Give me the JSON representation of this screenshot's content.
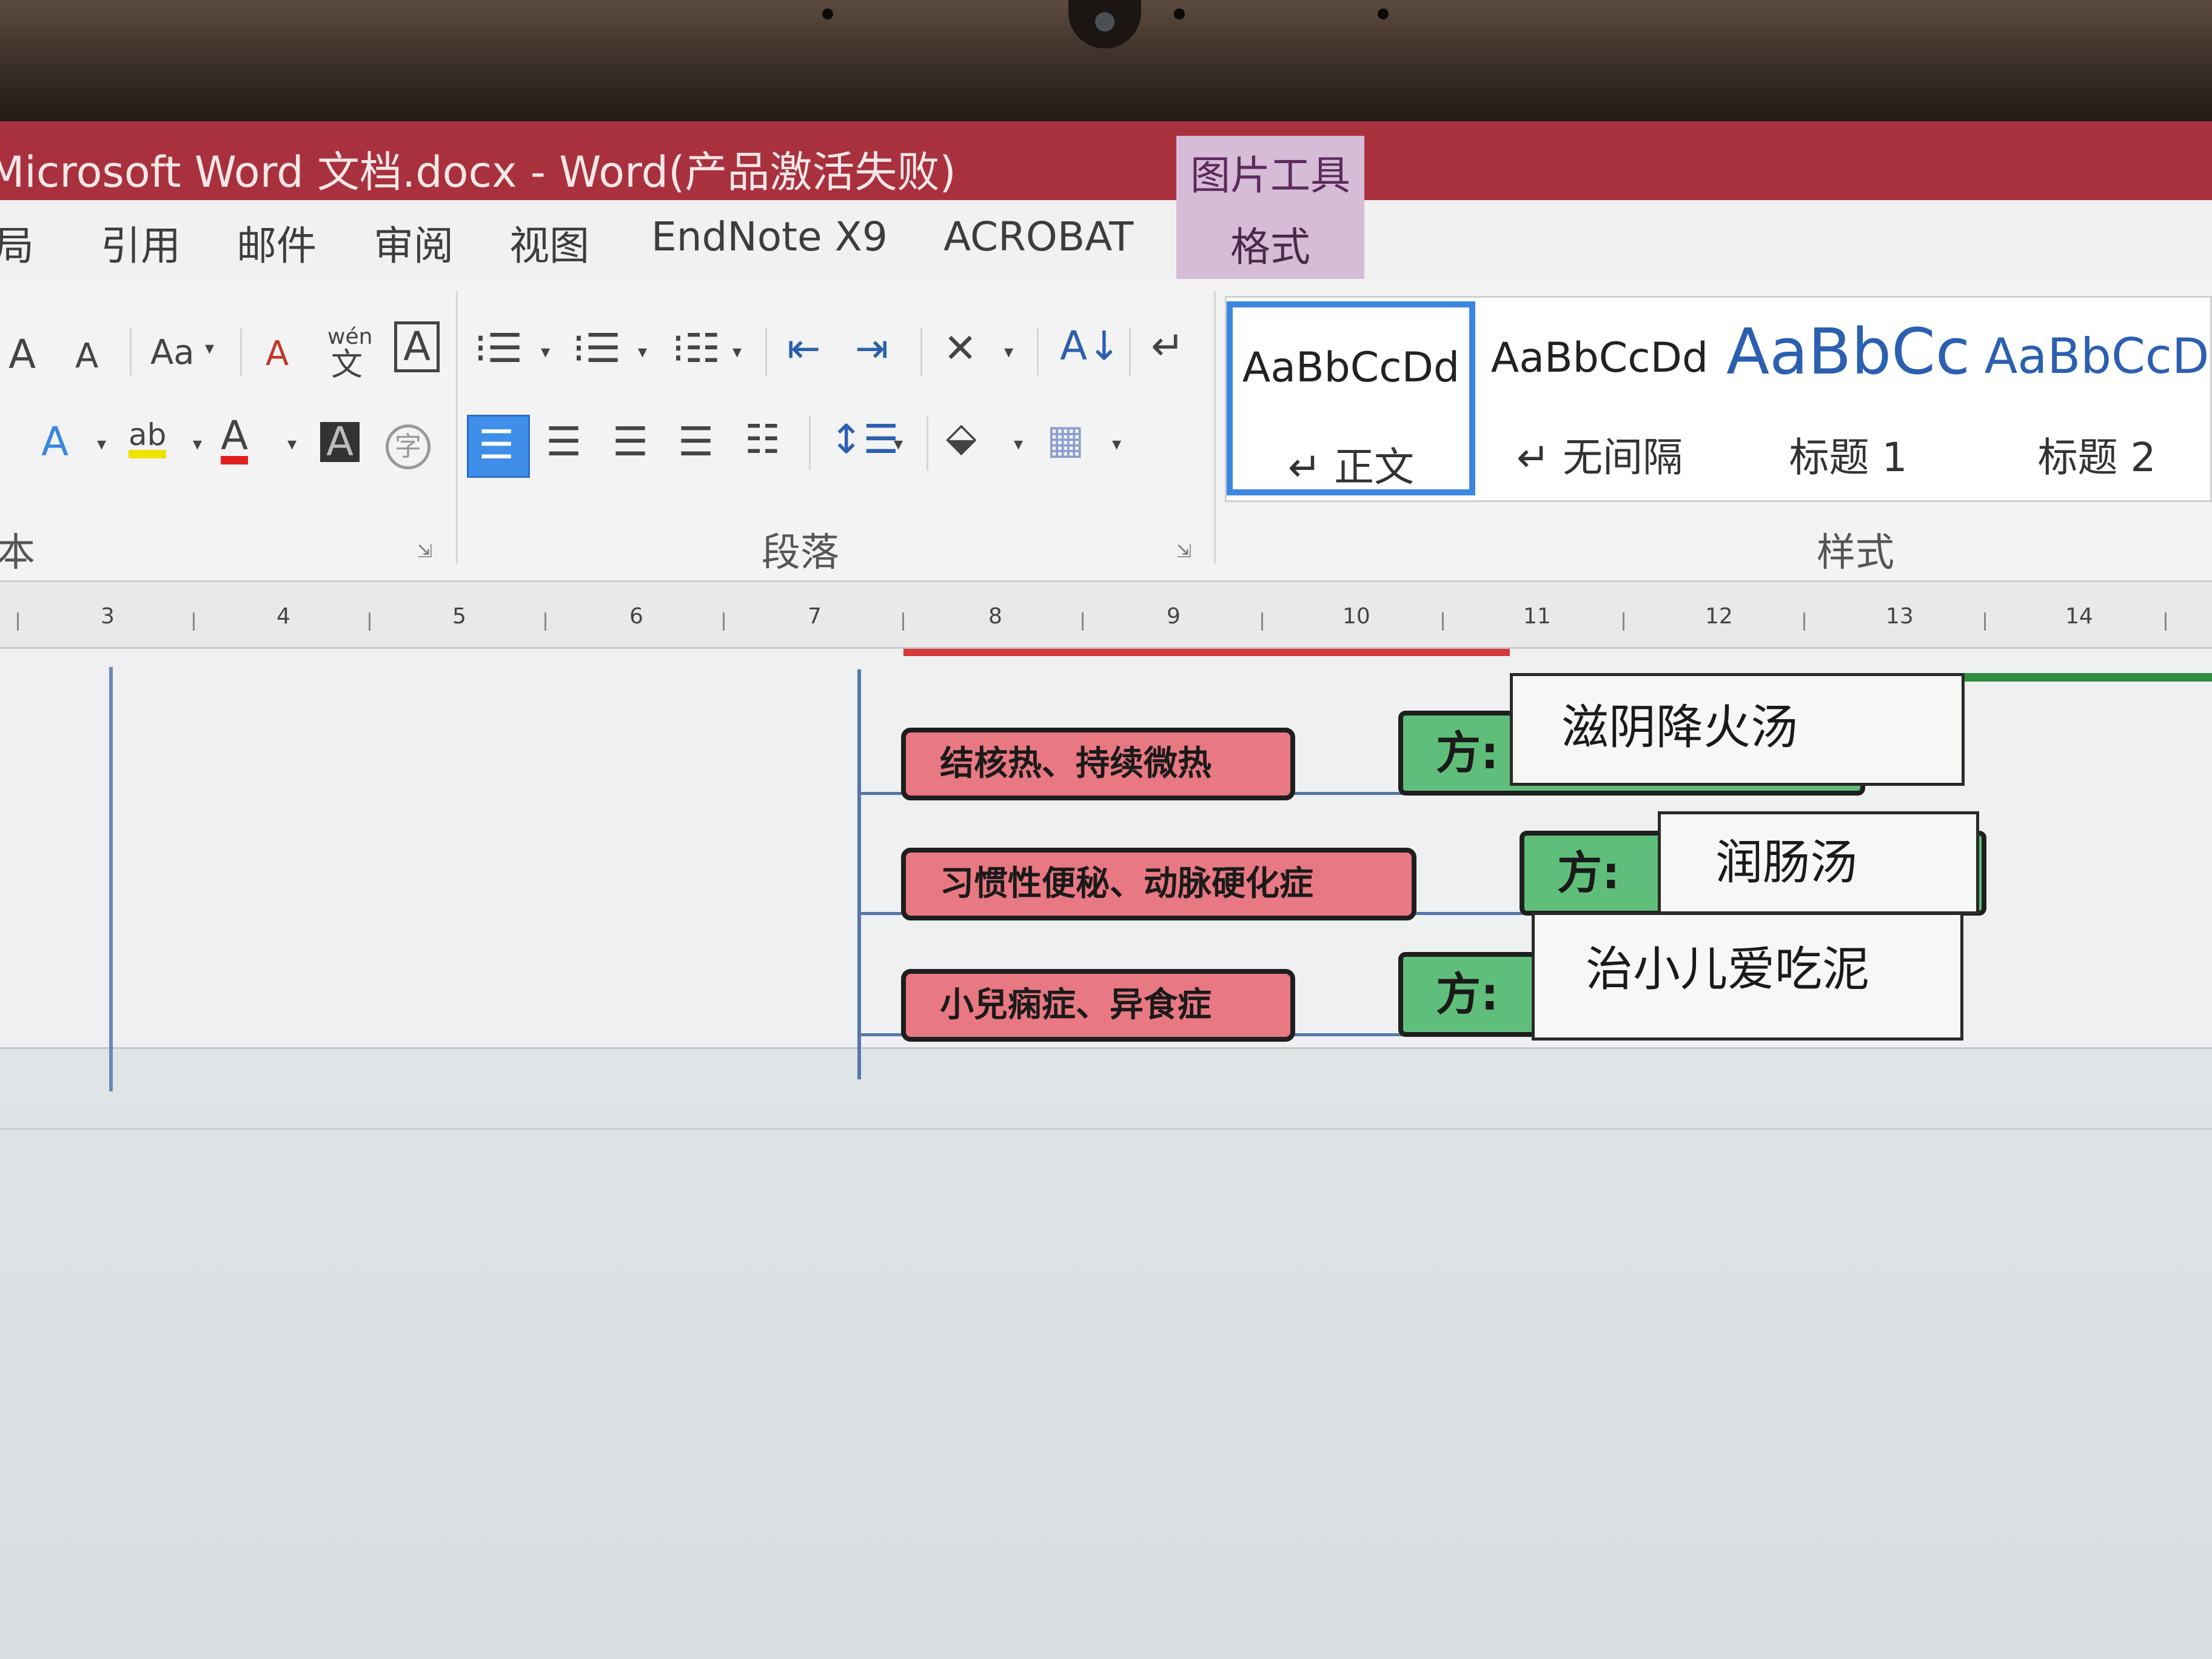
{
  "titlebar": {
    "title": "Microsoft Word 文档.docx -  Word(产品激活失败)"
  },
  "picture_tools": {
    "title": "图片工具",
    "tab": "格式"
  },
  "tabs": [
    "局",
    "引用",
    "邮件",
    "审阅",
    "视图",
    "EndNote X9",
    "ACROBAT"
  ],
  "ribbon": {
    "font_group_label": "本",
    "paragraph_group_label": "段落",
    "styles_group_label": "样式",
    "icons": {
      "grow_font": "A",
      "shrink_font": "A",
      "change_case": "Aa",
      "clear_format": "A",
      "phonetic_guide": "wén",
      "char_border": "A",
      "text_effect": "A",
      "highlight": "ab",
      "font_color": "A",
      "char_shading": "A",
      "enclose_char": "字"
    },
    "styles": [
      {
        "sample": "AaBbCcDd",
        "name": "正文",
        "mark": "↵"
      },
      {
        "sample": "AaBbCcDd",
        "name": "无间隔",
        "mark": "↵"
      },
      {
        "sample": "AaBbCc",
        "name": "标题 1"
      },
      {
        "sample": "AaBbCcD",
        "name": "标题 2"
      }
    ]
  },
  "ruler": {
    "numbers": [
      "3",
      "4",
      "5",
      "6",
      "7",
      "8",
      "9",
      "10",
      "11",
      "12",
      "13",
      "14"
    ]
  },
  "document": {
    "rows": [
      {
        "condition": "结核热、持续微热",
        "prefix": "方:",
        "remedy": "滋阴降火汤"
      },
      {
        "condition": "习惯性便秘、动脉硬化症",
        "prefix": "方:",
        "remedy": "润肠汤"
      },
      {
        "condition": "小兒痫症、异食症",
        "prefix": "方:",
        "remedy": "治小儿爱吃泥"
      }
    ]
  },
  "colors": {
    "titlebar": "#a8313d",
    "picture_tools": "#d6bcd6",
    "condition_box": "#e87882",
    "prefix_box": "#5fbf7a",
    "selected_style": "#3b86e0"
  }
}
